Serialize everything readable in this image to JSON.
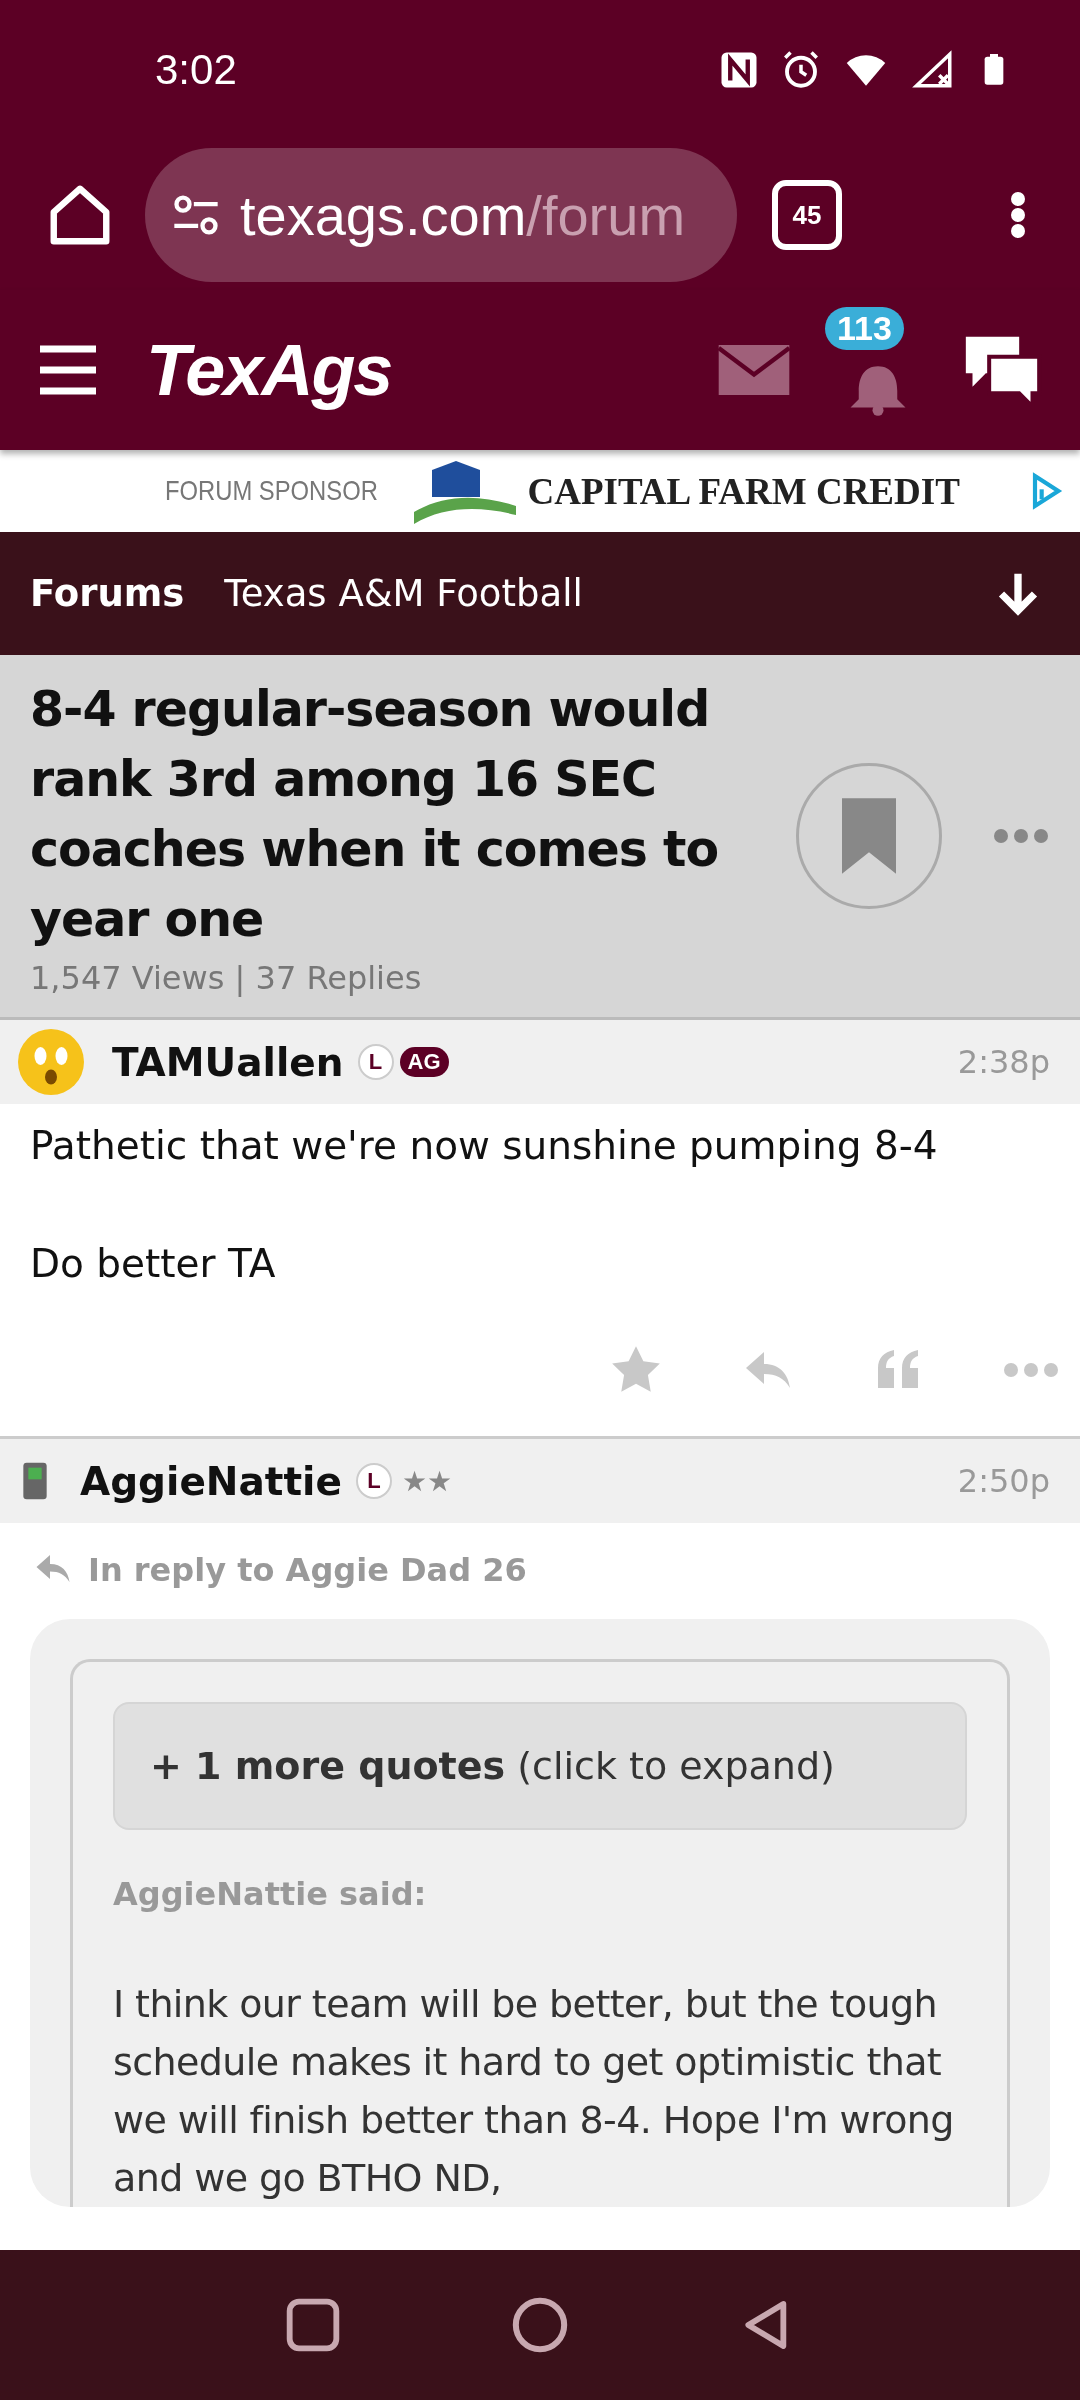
{
  "status_bar": {
    "time": "3:02"
  },
  "browser": {
    "url_host": "texags.com",
    "url_path": "/forum",
    "tab_count": "45"
  },
  "site_header": {
    "logo": "TexAgs",
    "notification_count": "113"
  },
  "sponsor": {
    "label": "FORUM SPONSOR",
    "name": "CAPITAL FARM CREDIT"
  },
  "breadcrumb": {
    "root": "Forums",
    "forum": "Texas A&M Football"
  },
  "thread": {
    "title": "8-4 regular-season would rank 3rd among 16 SEC coaches when it comes to year one",
    "stats": "1,547 Views | 37 Replies",
    "bookmarked": false
  },
  "posts": [
    {
      "author": "TAMUallen",
      "avatar": {
        "kind": "emoji"
      },
      "badges": [
        {
          "kind": "circle",
          "text": "L"
        },
        {
          "kind": "pill",
          "text": "AG"
        }
      ],
      "time": "2:38p",
      "paragraphs": [
        "Pathetic that we're now sunshine pumping 8-4",
        "Do better TA"
      ]
    },
    {
      "author": "AggieNattie",
      "avatar": {
        "kind": "phone"
      },
      "badges": [
        {
          "kind": "circle",
          "text": "L"
        },
        {
          "kind": "rank",
          "text": "★★"
        }
      ],
      "time": "2:50p",
      "reply_to": "In reply to Aggie Dad 26",
      "quote": {
        "expand": "**+ 1 more quotes** (click to expand)",
        "said": "AggieNattie said:",
        "text": "I think our team will be better, but the tough schedule makes it hard to get optimistic that we will finish better than 8-4. Hope I'm wrong and we go BTHO ND,"
      }
    }
  ]
}
